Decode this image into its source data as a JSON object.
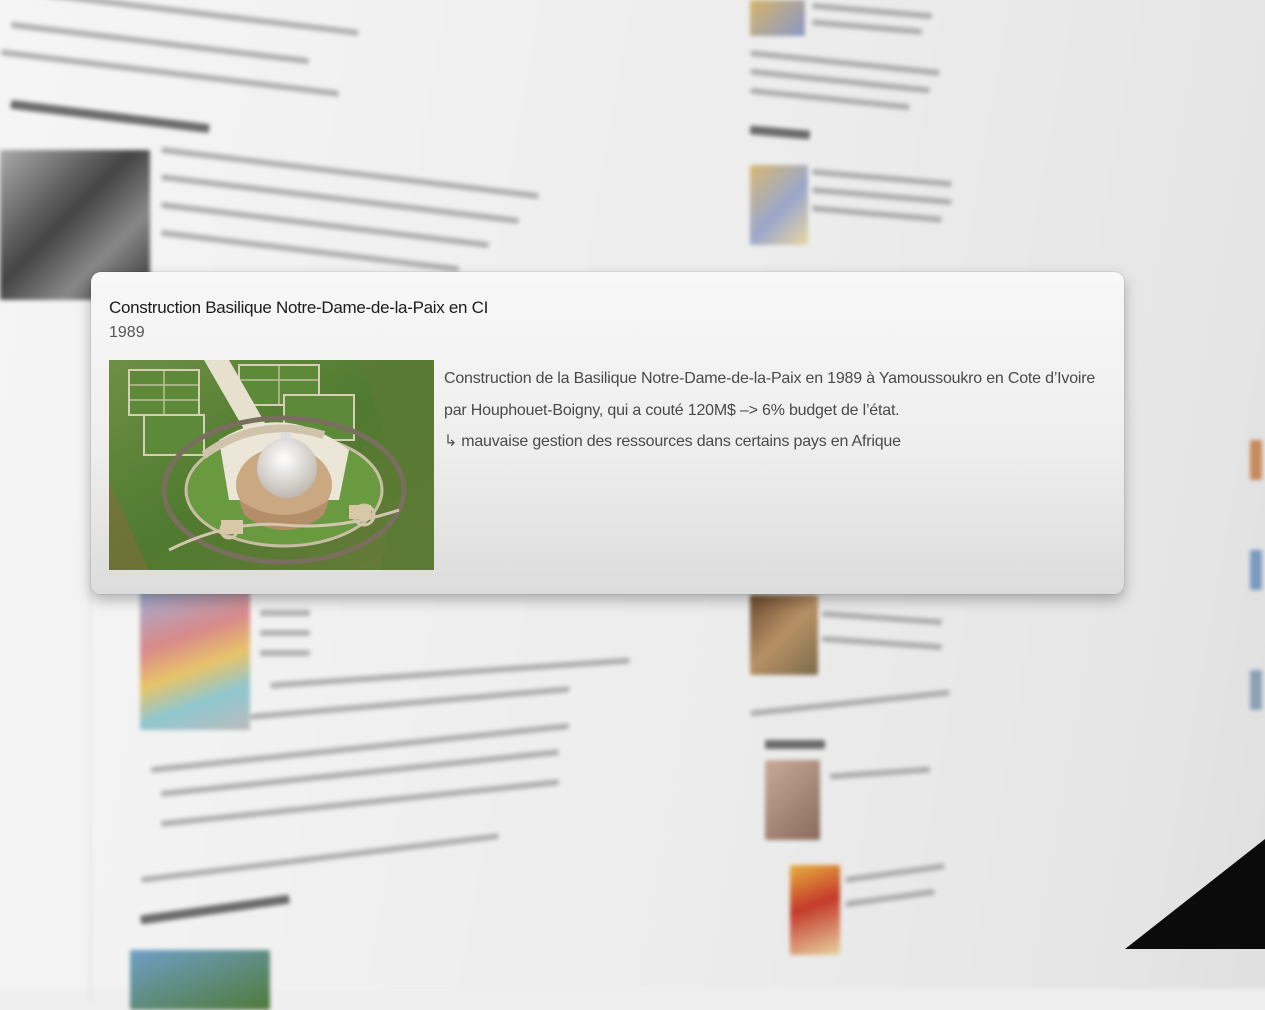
{
  "card": {
    "title": "Construction Basilique Notre-Dame-de-la-Paix en CI",
    "date": "1989",
    "image_alt": "Aerial view of the Basilica of Our Lady of Peace in Yamoussoukro",
    "lines": [
      "Construction de la Basilique Notre-Dame-de-la-Paix en 1989 à Yamoussoukro en Cote d’Ivoire",
      "par Houphouet-Boigny, qui a couté 120M$ –> 6% budget de l’état.",
      "mauvaise gestion des ressources dans certains pays en Afrique"
    ],
    "return_arrow": "↳"
  },
  "colors": {
    "card_bg": "#f2f2f2",
    "title": "#1c1c1c",
    "body_text": "#4a4a4a",
    "page_bg": "#efefef"
  }
}
